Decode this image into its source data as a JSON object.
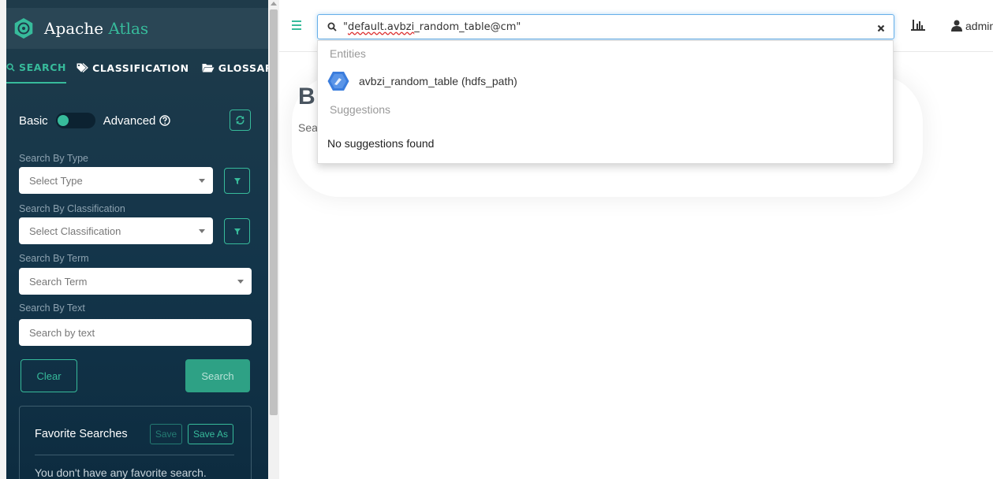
{
  "brand": {
    "prefix": "Apache ",
    "accent": "Atlas"
  },
  "tabs": [
    {
      "label": "SEARCH",
      "icon": "search-icon",
      "active": true
    },
    {
      "label": "CLASSIFICATION",
      "icon": "tag-icon",
      "active": false
    },
    {
      "label": "GLOSSARY",
      "icon": "folder-icon",
      "active": false
    }
  ],
  "mode_toggle": {
    "basic": "Basic",
    "advanced": "Advanced"
  },
  "filters": {
    "type": {
      "label": "Search By Type",
      "placeholder": "Select Type"
    },
    "classification": {
      "label": "Search By Classification",
      "placeholder": "Select Classification"
    },
    "term": {
      "label": "Search By Term",
      "placeholder": "Search Term"
    },
    "text": {
      "label": "Search By Text",
      "placeholder": "Search by text"
    }
  },
  "buttons": {
    "clear": "Clear",
    "search": "Search"
  },
  "favorites": {
    "title": "Favorite Searches",
    "save": "Save",
    "save_as": "Save As",
    "empty": "You don't have any favorite search."
  },
  "header": {
    "query_prefix": "\"",
    "query_misspelled": "default.avbzi",
    "query_rest": "_random_table@cm\"",
    "user": "admin"
  },
  "main": {
    "heading": "B",
    "sub": "Sea"
  },
  "dropdown": {
    "entities_label": "Entities",
    "entity_name": "avbzi_random_table (hdfs_path)",
    "suggestions_label": "Suggestions",
    "no_suggestions": "No suggestions found"
  },
  "colors": {
    "accent": "#37bb9b",
    "sidebar": "#13354a",
    "entity_badge": "#3b7ddd"
  }
}
